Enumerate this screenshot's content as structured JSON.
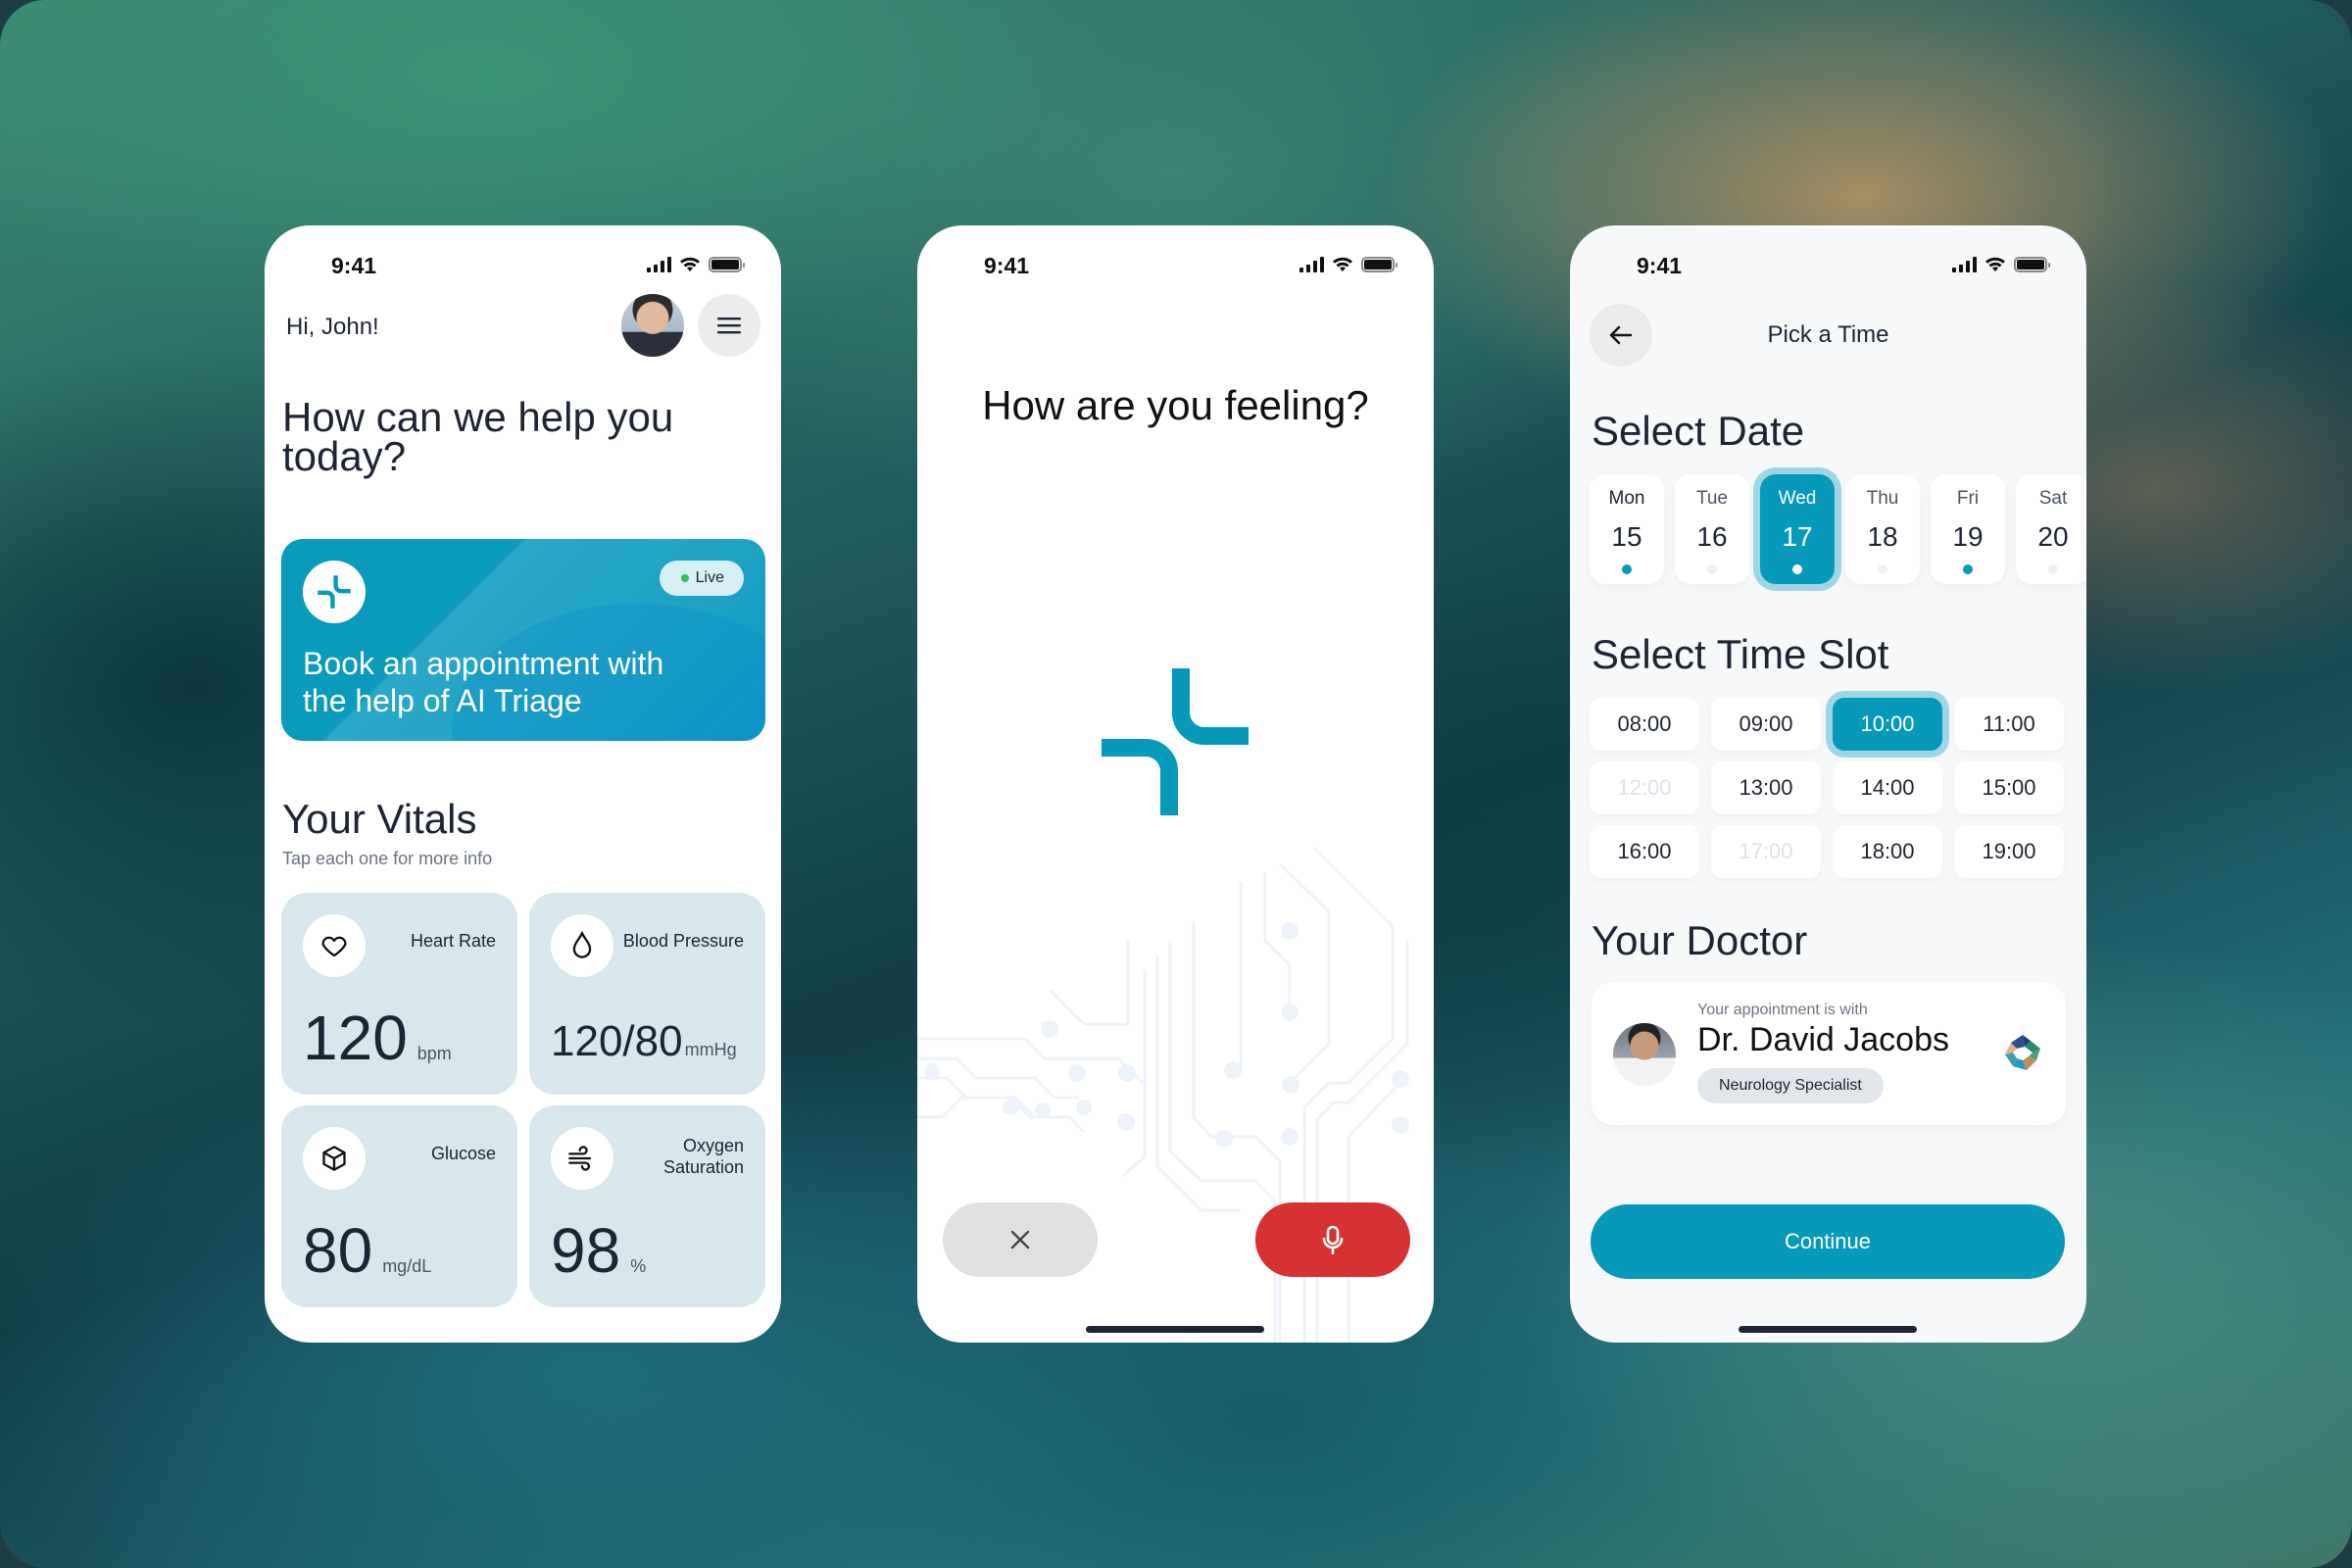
{
  "status_bar": {
    "time": "9:41"
  },
  "home_screen": {
    "greeting": "Hi, John!",
    "headline": "How can we help you today?",
    "ai_card": {
      "badge": "Live",
      "text": "Book an appointment with the help of AI Triage"
    },
    "vitals": {
      "title": "Your Vitals",
      "subtitle": "Tap each one for more info",
      "items": [
        {
          "label": "Heart Rate",
          "value": "120",
          "unit": "bpm",
          "icon": "heart-icon"
        },
        {
          "label": "Blood Pressure",
          "value": "120/80",
          "unit": "mmHg",
          "icon": "droplet-icon"
        },
        {
          "label": "Glucose",
          "value": "80",
          "unit": "mg/dL",
          "icon": "cube-icon"
        },
        {
          "label": "Oxygen Saturation",
          "value": "98",
          "unit": "%",
          "icon": "wind-icon"
        }
      ]
    }
  },
  "voice_screen": {
    "question": "How are you feeling?",
    "cancel_icon": "close-icon",
    "mic_icon": "microphone-icon"
  },
  "booking_screen": {
    "nav_title": "Pick a Time",
    "date_section": "Select Date",
    "dates": [
      {
        "day": "Mon",
        "num": "15",
        "available": true,
        "selected": false
      },
      {
        "day": "Tue",
        "num": "16",
        "available": false,
        "selected": false
      },
      {
        "day": "Wed",
        "num": "17",
        "available": true,
        "selected": true
      },
      {
        "day": "Thu",
        "num": "18",
        "available": false,
        "selected": false
      },
      {
        "day": "Fri",
        "num": "19",
        "available": true,
        "selected": false
      },
      {
        "day": "Sat",
        "num": "20",
        "available": false,
        "selected": false
      }
    ],
    "time_section": "Select Time Slot",
    "slots": [
      {
        "time": "08:00",
        "state": "available"
      },
      {
        "time": "09:00",
        "state": "available"
      },
      {
        "time": "10:00",
        "state": "selected"
      },
      {
        "time": "11:00",
        "state": "available"
      },
      {
        "time": "12:00",
        "state": "disabled"
      },
      {
        "time": "13:00",
        "state": "available"
      },
      {
        "time": "14:00",
        "state": "available"
      },
      {
        "time": "15:00",
        "state": "available"
      },
      {
        "time": "16:00",
        "state": "available"
      },
      {
        "time": "17:00",
        "state": "disabled"
      },
      {
        "time": "18:00",
        "state": "available"
      },
      {
        "time": "19:00",
        "state": "available"
      }
    ],
    "doctor_section": "Your Doctor",
    "doctor": {
      "intro": "Your appointment is with",
      "name": "Dr. David Jacobs",
      "specialty": "Neurology Specialist"
    },
    "continue_label": "Continue"
  },
  "colors": {
    "accent": "#0799b9",
    "accent_ring": "#9fd6e4",
    "danger": "#d63232",
    "vital_card": "#d7e7ec",
    "text_dark": "#1d2433",
    "live_dot": "#2fc15a"
  }
}
